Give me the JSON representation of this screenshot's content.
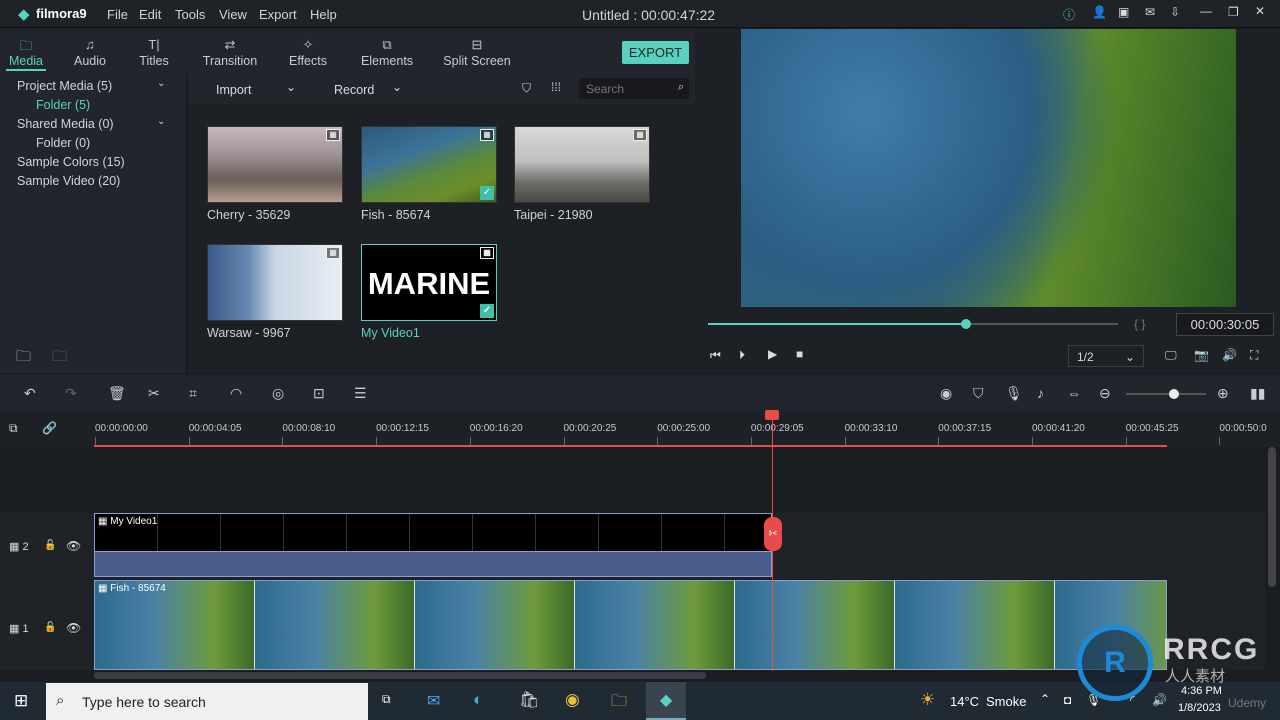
{
  "app": {
    "logo": "filmora9",
    "title": "Untitled : 00:00:47:22",
    "menu": [
      "File",
      "Edit",
      "Tools",
      "View",
      "Export",
      "Help"
    ]
  },
  "tabs": [
    {
      "label": "Media",
      "icon": "folder-icon"
    },
    {
      "label": "Audio",
      "icon": "music-icon"
    },
    {
      "label": "Titles",
      "icon": "text-icon"
    },
    {
      "label": "Transition",
      "icon": "transition-icon"
    },
    {
      "label": "Effects",
      "icon": "effects-icon"
    },
    {
      "label": "Elements",
      "icon": "elements-icon"
    },
    {
      "label": "Split Screen",
      "icon": "split-screen-icon"
    }
  ],
  "export_label": "EXPORT",
  "sidebar": [
    {
      "label": "Project Media (5)"
    },
    {
      "label": "Folder (5)"
    },
    {
      "label": "Shared Media (0)"
    },
    {
      "label": "Folder (0)"
    },
    {
      "label": "Sample Colors (15)"
    },
    {
      "label": "Sample Video (20)"
    }
  ],
  "media_toolbar": {
    "import": "Import",
    "record": "Record",
    "search_placeholder": "Search"
  },
  "media": [
    {
      "label": "Cherry - 35629"
    },
    {
      "label": "Fish - 85674",
      "checked": true
    },
    {
      "label": "Taipei - 21980"
    },
    {
      "label": "Warsaw - 9967"
    },
    {
      "label": "My Video1",
      "checked": true,
      "text": "MARINE"
    }
  ],
  "preview": {
    "time": "00:00:30:05",
    "progress": 0.63,
    "quality": "1/2",
    "brackets": "{  }"
  },
  "ruler": [
    "00:00:00:00",
    "00:00:04:05",
    "00:00:08:10",
    "00:00:12:15",
    "00:00:16:20",
    "00:00:20:25",
    "00:00:25:00",
    "00:00:29:05",
    "00:00:33:10",
    "00:00:37:15",
    "00:00:41:20",
    "00:00:45:25",
    "00:00:50:0"
  ],
  "tracks": [
    {
      "num": "2",
      "clip": "My Video1"
    },
    {
      "num": "1",
      "clip": "Fish - 85674"
    }
  ],
  "zoom_level": 0.6,
  "taskbar": {
    "search": "Type here to search",
    "weather": "14°C",
    "weather_text": "Smoke",
    "time": "4:36 PM",
    "date": "1/8/2023"
  },
  "watermark": {
    "text": "RRCG",
    "sub": "人人素材",
    "corner": "Udemy"
  },
  "colors": {
    "accent": "#5ad0c0",
    "playhead": "#e94a4a"
  }
}
